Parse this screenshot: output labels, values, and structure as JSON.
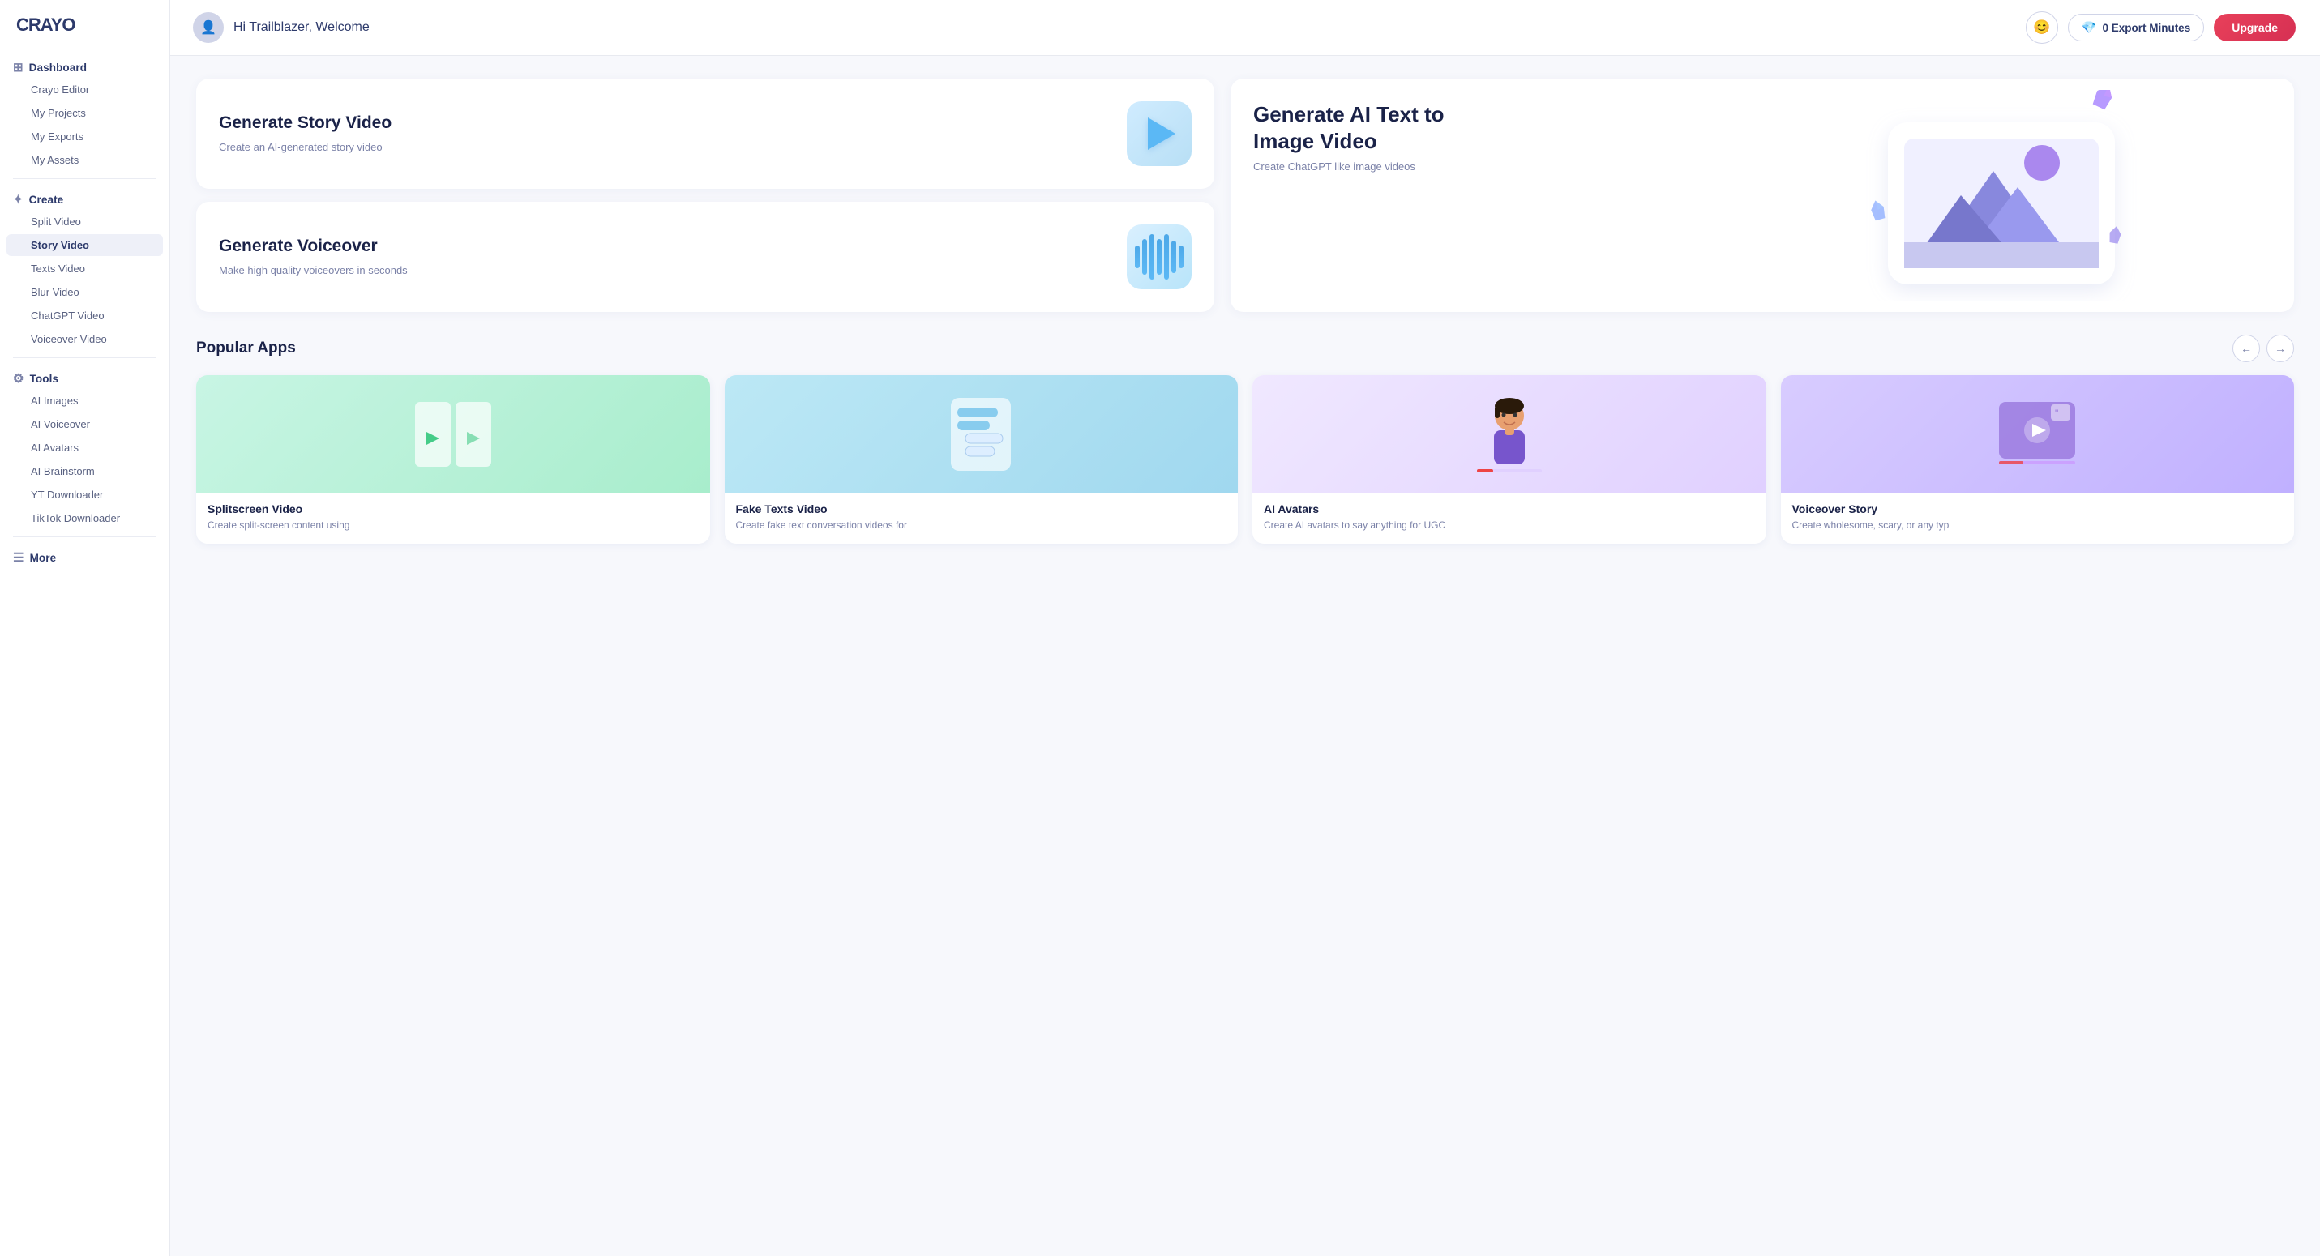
{
  "logo": "CRAYO",
  "sidebar": {
    "dashboard_label": "Dashboard",
    "nav_items_dashboard": [
      {
        "id": "crayo-editor",
        "label": "Crayo Editor"
      },
      {
        "id": "my-projects",
        "label": "My Projects"
      },
      {
        "id": "my-exports",
        "label": "My Exports"
      },
      {
        "id": "my-assets",
        "label": "My Assets"
      }
    ],
    "create_label": "Create",
    "nav_items_create": [
      {
        "id": "split-video",
        "label": "Split Video"
      },
      {
        "id": "story-video",
        "label": "Story Video"
      },
      {
        "id": "texts-video",
        "label": "Texts Video"
      },
      {
        "id": "blur-video",
        "label": "Blur Video"
      },
      {
        "id": "chatgpt-video",
        "label": "ChatGPT Video"
      },
      {
        "id": "voiceover-video",
        "label": "Voiceover Video"
      }
    ],
    "tools_label": "Tools",
    "nav_items_tools": [
      {
        "id": "ai-images",
        "label": "AI Images"
      },
      {
        "id": "ai-voiceover",
        "label": "AI Voiceover"
      },
      {
        "id": "ai-avatars",
        "label": "AI Avatars"
      },
      {
        "id": "ai-brainstorm",
        "label": "AI Brainstorm"
      },
      {
        "id": "yt-downloader",
        "label": "YT Downloader"
      },
      {
        "id": "tiktok-downloader",
        "label": "TikTok Downloader"
      }
    ],
    "more_label": "More"
  },
  "header": {
    "welcome_text": "Hi Trailblazer, Welcome",
    "export_minutes_label": "0 Export Minutes",
    "upgrade_label": "Upgrade"
  },
  "hero_cards": {
    "story_video": {
      "title": "Generate Story Video",
      "description": "Create an AI-generated story video"
    },
    "voiceover": {
      "title": "Generate Voiceover",
      "description": "Make high quality voiceovers in seconds"
    },
    "ai_text_image": {
      "title": "Generate AI Text to Image Video",
      "description": "Create ChatGPT like image videos"
    }
  },
  "popular_apps": {
    "section_title": "Popular Apps",
    "arrow_left": "←",
    "arrow_right": "→",
    "apps": [
      {
        "id": "splitscreen",
        "title": "Splitscreen Video",
        "description": "Create split-screen content using"
      },
      {
        "id": "faketexts",
        "title": "Fake Texts Video",
        "description": "Create fake text conversation videos for"
      },
      {
        "id": "ai-avatars-app",
        "title": "AI Avatars",
        "description": "Create AI avatars to say anything for UGC"
      },
      {
        "id": "voiceover-story",
        "title": "Voiceover Story",
        "description": "Create wholesome, scary, or any typ"
      }
    ]
  }
}
